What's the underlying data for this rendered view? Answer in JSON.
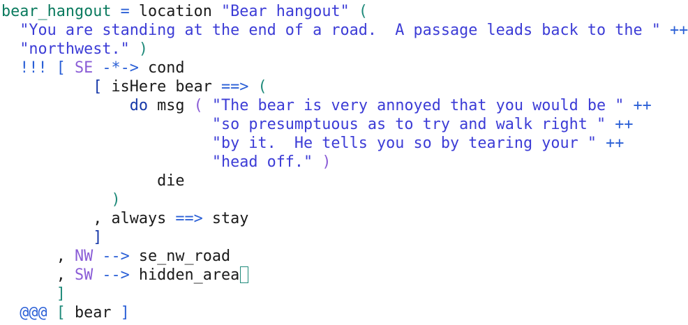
{
  "colors": {
    "background": "#ffffff",
    "text": "#1a1a1a",
    "definition": "#0a7a5e",
    "string": "#3c3cd6",
    "operator": "#2a5fd6",
    "constructor": "#8a5cd6",
    "keyword": "#1537a8",
    "paren": "#1f8a7a",
    "cursor": "#1f8a7a"
  },
  "editor": {
    "cursor_after": "hidden_area",
    "lines": [
      {
        "indent": "",
        "tokens": [
          {
            "text": "bear_hangout",
            "kind": "definition"
          },
          {
            "text": " ",
            "kind": "plain"
          },
          {
            "text": "=",
            "kind": "operator"
          },
          {
            "text": " location ",
            "kind": "plain"
          },
          {
            "text": "\"Bear hangout\"",
            "kind": "string"
          },
          {
            "text": " ",
            "kind": "plain"
          },
          {
            "text": "(",
            "kind": "paren"
          }
        ]
      },
      {
        "indent": "  ",
        "tokens": [
          {
            "text": "\"You are standing at the end of a road.  A passage leads back to the \"",
            "kind": "string"
          },
          {
            "text": " ",
            "kind": "plain"
          },
          {
            "text": "++",
            "kind": "operator"
          }
        ]
      },
      {
        "indent": "  ",
        "tokens": [
          {
            "text": "\"northwest.\"",
            "kind": "string"
          },
          {
            "text": " ",
            "kind": "plain"
          },
          {
            "text": ")",
            "kind": "paren"
          }
        ]
      },
      {
        "indent": "  ",
        "tokens": [
          {
            "text": "!!!",
            "kind": "operator"
          },
          {
            "text": " ",
            "kind": "plain"
          },
          {
            "text": "[",
            "kind": "operator"
          },
          {
            "text": " ",
            "kind": "plain"
          },
          {
            "text": "SE",
            "kind": "constructor"
          },
          {
            "text": " ",
            "kind": "plain"
          },
          {
            "text": "-*->",
            "kind": "operator"
          },
          {
            "text": " cond",
            "kind": "plain"
          }
        ]
      },
      {
        "indent": "          ",
        "tokens": [
          {
            "text": "[",
            "kind": "keyword"
          },
          {
            "text": " isHere bear ",
            "kind": "plain"
          },
          {
            "text": "==>",
            "kind": "operator"
          },
          {
            "text": " ",
            "kind": "plain"
          },
          {
            "text": "(",
            "kind": "paren"
          }
        ]
      },
      {
        "indent": "              ",
        "tokens": [
          {
            "text": "do",
            "kind": "keyword"
          },
          {
            "text": " msg ",
            "kind": "plain"
          },
          {
            "text": "(",
            "kind": "constructor"
          },
          {
            "text": " ",
            "kind": "plain"
          },
          {
            "text": "\"The bear is very annoyed that you would be \"",
            "kind": "string"
          },
          {
            "text": " ",
            "kind": "plain"
          },
          {
            "text": "++",
            "kind": "operator"
          }
        ]
      },
      {
        "indent": "                       ",
        "tokens": [
          {
            "text": "\"so presumptuous as to try and walk right \"",
            "kind": "string"
          },
          {
            "text": " ",
            "kind": "plain"
          },
          {
            "text": "++",
            "kind": "operator"
          }
        ]
      },
      {
        "indent": "                       ",
        "tokens": [
          {
            "text": "\"by it.  He tells you so by tearing your \"",
            "kind": "string"
          },
          {
            "text": " ",
            "kind": "plain"
          },
          {
            "text": "++",
            "kind": "operator"
          }
        ]
      },
      {
        "indent": "                       ",
        "tokens": [
          {
            "text": "\"head off.\"",
            "kind": "string"
          },
          {
            "text": " ",
            "kind": "plain"
          },
          {
            "text": ")",
            "kind": "constructor"
          }
        ]
      },
      {
        "indent": "                 ",
        "tokens": [
          {
            "text": "die",
            "kind": "plain"
          }
        ]
      },
      {
        "indent": "            ",
        "tokens": [
          {
            "text": ")",
            "kind": "paren"
          }
        ]
      },
      {
        "indent": "          ",
        "tokens": [
          {
            "text": ", always ",
            "kind": "plain"
          },
          {
            "text": "==>",
            "kind": "operator"
          },
          {
            "text": " stay",
            "kind": "plain"
          }
        ]
      },
      {
        "indent": "          ",
        "tokens": [
          {
            "text": "]",
            "kind": "keyword"
          }
        ]
      },
      {
        "indent": "      ",
        "tokens": [
          {
            "text": ", ",
            "kind": "plain"
          },
          {
            "text": "NW",
            "kind": "constructor"
          },
          {
            "text": " ",
            "kind": "plain"
          },
          {
            "text": "-->",
            "kind": "operator"
          },
          {
            "text": " se_nw_road",
            "kind": "plain"
          }
        ]
      },
      {
        "indent": "      ",
        "tokens": [
          {
            "text": ", ",
            "kind": "plain"
          },
          {
            "text": "SW",
            "kind": "constructor"
          },
          {
            "text": " ",
            "kind": "plain"
          },
          {
            "text": "-->",
            "kind": "operator"
          },
          {
            "text": " hidden_area",
            "kind": "plain"
          }
        ],
        "cursor": true
      },
      {
        "indent": "      ",
        "tokens": [
          {
            "text": "]",
            "kind": "paren"
          }
        ]
      },
      {
        "indent": "  ",
        "tokens": [
          {
            "text": "@@@",
            "kind": "operator"
          },
          {
            "text": " ",
            "kind": "plain"
          },
          {
            "text": "[",
            "kind": "paren"
          },
          {
            "text": " bear ",
            "kind": "plain"
          },
          {
            "text": "]",
            "kind": "operator"
          }
        ]
      }
    ]
  }
}
